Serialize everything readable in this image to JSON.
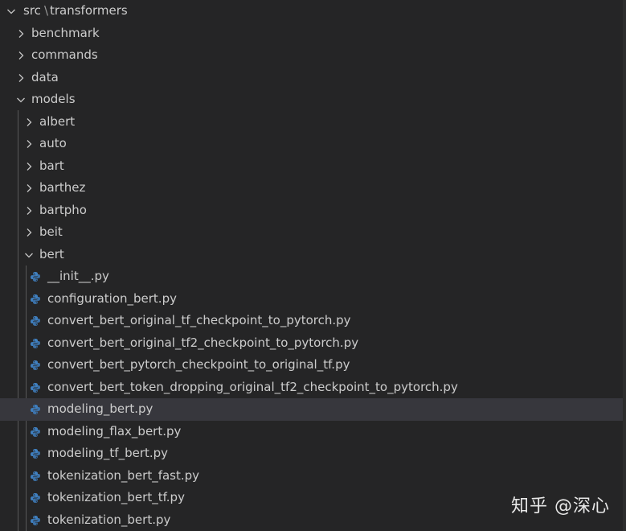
{
  "tree": {
    "root": {
      "segments": [
        "src",
        "transformers"
      ],
      "expanded": true
    },
    "folders_level1": [
      {
        "label": "benchmark",
        "expanded": false
      },
      {
        "label": "commands",
        "expanded": false
      },
      {
        "label": "data",
        "expanded": false
      },
      {
        "label": "models",
        "expanded": true
      }
    ],
    "folders_level2": [
      {
        "label": "albert",
        "expanded": false
      },
      {
        "label": "auto",
        "expanded": false
      },
      {
        "label": "bart",
        "expanded": false
      },
      {
        "label": "barthez",
        "expanded": false
      },
      {
        "label": "bartpho",
        "expanded": false
      },
      {
        "label": "beit",
        "expanded": false
      },
      {
        "label": "bert",
        "expanded": true
      }
    ],
    "files": [
      {
        "label": "__init__.py",
        "icon": "python-icon"
      },
      {
        "label": "configuration_bert.py",
        "icon": "python-icon"
      },
      {
        "label": "convert_bert_original_tf_checkpoint_to_pytorch.py",
        "icon": "python-icon"
      },
      {
        "label": "convert_bert_original_tf2_checkpoint_to_pytorch.py",
        "icon": "python-icon"
      },
      {
        "label": "convert_bert_pytorch_checkpoint_to_original_tf.py",
        "icon": "python-icon"
      },
      {
        "label": "convert_bert_token_dropping_original_tf2_checkpoint_to_pytorch.py",
        "icon": "python-icon"
      },
      {
        "label": "modeling_bert.py",
        "icon": "python-icon",
        "selected": true
      },
      {
        "label": "modeling_flax_bert.py",
        "icon": "python-icon"
      },
      {
        "label": "modeling_tf_bert.py",
        "icon": "python-icon"
      },
      {
        "label": "tokenization_bert_fast.py",
        "icon": "python-icon"
      },
      {
        "label": "tokenization_bert_tf.py",
        "icon": "python-icon"
      },
      {
        "label": "tokenization_bert.py",
        "icon": "python-icon"
      }
    ]
  },
  "watermark": {
    "text": "知乎 @深心"
  },
  "colors": {
    "background": "#252526",
    "text": "#cccccc",
    "selected_row": "#37373d",
    "python_blue": "#3f7fbf",
    "python_yellow": "#e8c547",
    "indent_guide": "#585858"
  }
}
